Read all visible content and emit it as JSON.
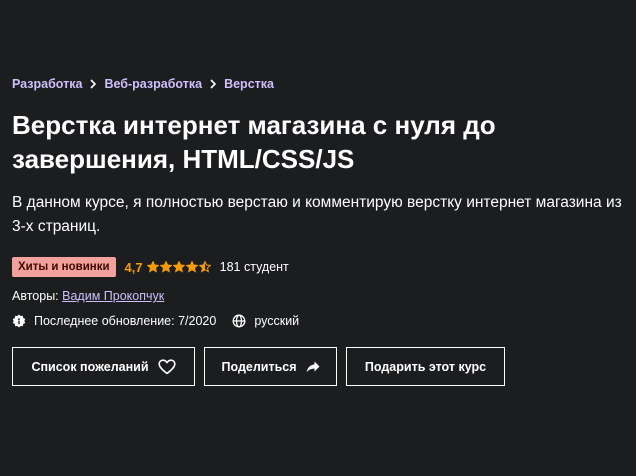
{
  "breadcrumb": {
    "items": [
      {
        "label": "Разработка"
      },
      {
        "label": "Веб-разработка"
      },
      {
        "label": "Верстка"
      }
    ]
  },
  "course": {
    "title": "Верстка интернет магазина с нуля до завершения, HTML/CSS/JS",
    "subtitle": "В данном курсе, я полностью верстаю и комментирую верстку интернет магазина из 3-х страниц.",
    "badge": "Хиты и новинки",
    "rating": "4,7",
    "rating_stars": 4.5,
    "students": "181 студент",
    "authors_label": "Авторы:",
    "author": "Вадим Прокопчук",
    "updated": "Последнее обновление: 7/2020",
    "language": "русский"
  },
  "actions": {
    "wishlist": "Список пожеланий",
    "share": "Поделиться",
    "gift": "Подарить этот курс"
  },
  "colors": {
    "background": "#1c1d1f",
    "link": "#cec0fc",
    "rating": "#f69c08",
    "badge_bg": "#f3a19d",
    "badge_text": "#3d0801"
  },
  "icons": {
    "breadcrumb_separator": "chevron-right-icon",
    "star": "star-icon",
    "update": "update-badge-icon",
    "language": "globe-icon",
    "wishlist": "heart-icon",
    "share": "share-arrow-icon"
  }
}
